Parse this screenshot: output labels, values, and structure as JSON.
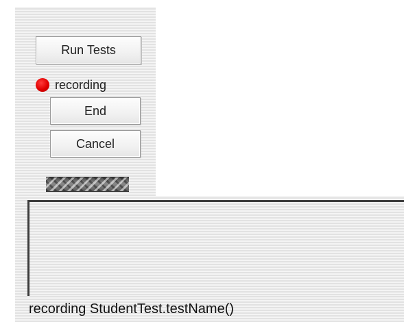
{
  "toolbar": {
    "run_tests_label": "Run Tests",
    "end_label": "End",
    "cancel_label": "Cancel"
  },
  "recording": {
    "label": "recording",
    "indicator_color": "#e00000"
  },
  "output": {
    "text": ""
  },
  "status": {
    "message": "recording StudentTest.testName()"
  }
}
